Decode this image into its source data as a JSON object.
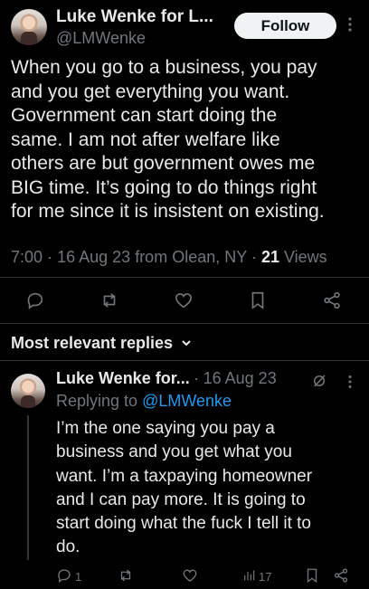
{
  "tweet": {
    "author_name": "Luke Wenke for L...",
    "author_handle": "@LMWenke",
    "follow_label": "Follow",
    "text": "When you go to a business, you pay\nand you get everything you want.\nGovernment can start doing the\nsame.  I am not after welfare like\nothers are but government owes me\nBIG time.  It’s going to do things right\nfor me since it is insistent on existing.",
    "time": "7:00",
    "date": "16 Aug 23",
    "location": "from Olean, NY",
    "views_count": "21",
    "views_label": "Views",
    "sep": "·"
  },
  "replies_header": {
    "label": "Most relevant replies",
    "chevron": "⌄"
  },
  "reply": {
    "author_name": "Luke Wenke for...",
    "sep": "·",
    "date": "16 Aug 23",
    "replying_prefix": "Replying to",
    "replying_handle": "@LMWenke",
    "text": "I’m the one saying you pay a\nbusiness and you get what you\nwant.  I’m a taxpaying homeowner\nand I can pay more.  It is going to\nstart doing what the fuck I tell it to\ndo.",
    "reply_count": "1",
    "views_count": "17"
  },
  "icons": {
    "reply": "comment-icon",
    "retweet": "retweet-icon",
    "like": "heart-icon",
    "bookmark": "bookmark-icon",
    "share": "share-icon",
    "more": "more-icon",
    "grok": "grok-icon",
    "views": "views-icon"
  },
  "colors": {
    "background": "#000000",
    "text": "#e7e9ea",
    "muted": "#71767b",
    "link": "#1d9bf0",
    "follow_bg": "#eff3f4"
  }
}
